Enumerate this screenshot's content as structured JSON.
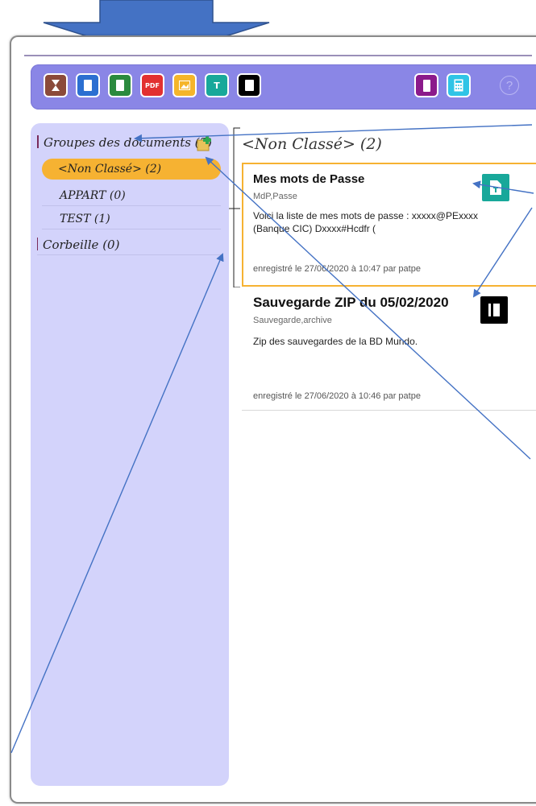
{
  "colors": {
    "toolbar_bg": "#8a86e6",
    "sidebar_bg": "#d3d3fb",
    "active_item": "#f6b232",
    "annotation_arrow": "#4472c4"
  },
  "toolbar": {
    "icons": [
      {
        "name": "hourglass-icon",
        "color": "#8b4a3a"
      },
      {
        "name": "document-icon",
        "color": "#2c6fd1"
      },
      {
        "name": "spreadsheet-icon",
        "color": "#2b8a3e"
      },
      {
        "name": "pdf-icon",
        "color": "#e23030",
        "label": "PDF"
      },
      {
        "name": "image-icon",
        "color": "#f5b52a"
      },
      {
        "name": "text-icon",
        "color": "#18a89a",
        "label": "T"
      },
      {
        "name": "archive-icon",
        "color": "#000000"
      },
      {
        "name": "clipboard-icon",
        "color": "#8b1a8b"
      },
      {
        "name": "calculator-icon",
        "color": "#2fc4e6"
      }
    ],
    "help_label": "?"
  },
  "sidebar": {
    "title": "Groupes des documents (3)",
    "items": [
      {
        "label": "<Non Classé> (2)",
        "active": true
      },
      {
        "label": "APPART (0)",
        "active": false
      },
      {
        "label": "TEST (1)",
        "active": false
      }
    ],
    "trash_label": "Corbeille (0)"
  },
  "main": {
    "title": "<Non Classé> (2)",
    "documents": [
      {
        "title": "Mes mots de Passe",
        "tags": "MdP,Passe",
        "description": "Voici la liste de mes mots de passe : xxxxx@PExxxx (Banque CIC) Dxxxx#Hcdfr (",
        "meta": "enregistré le 27/06/2020 à 10:47 par patpe",
        "icon": "text-document-icon"
      },
      {
        "title": "Sauvegarde ZIP du 05/02/2020",
        "tags": "Sauvegarde,archive",
        "description": "Zip des sauvegardes de la BD Mundo.",
        "meta": "enregistré le 27/06/2020 à 10:46 par patpe",
        "icon": "archive-icon"
      }
    ]
  }
}
